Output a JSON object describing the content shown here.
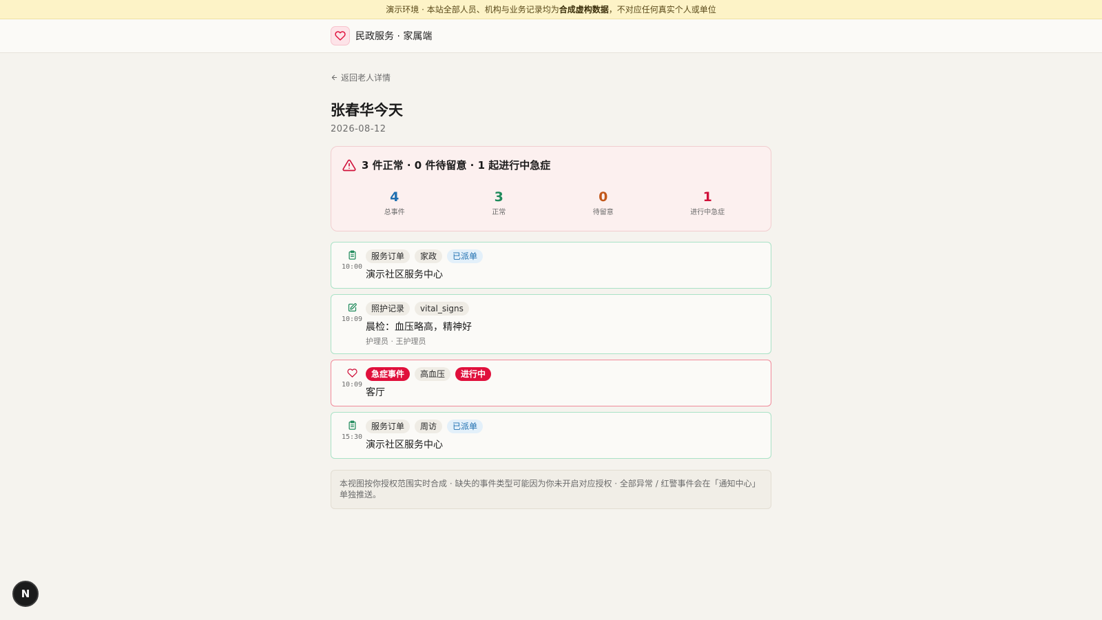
{
  "banner": {
    "prefix": "演示环境 · 本站全部人员、机构与业务记录均为",
    "bold": "合成虚构数据",
    "suffix": "，不对应任何真实个人或单位"
  },
  "header": {
    "brand_name": "民政服务 · 家属端",
    "brand_icon": "heart-icon"
  },
  "nav": {
    "back_label": "返回老人详情"
  },
  "page": {
    "title": "张春华今天",
    "date": "2026-08-12"
  },
  "summary": {
    "headline": "3 件正常 · 0 件待留意 · 1 起进行中急症",
    "stats": [
      {
        "value": "4",
        "label": "总事件",
        "color": "#1f6fb0"
      },
      {
        "value": "3",
        "label": "正常",
        "color": "#1f8a5b"
      },
      {
        "value": "0",
        "label": "待留意",
        "color": "#c2581a"
      },
      {
        "value": "1",
        "label": "进行中急症",
        "color": "#d0103a"
      }
    ]
  },
  "events": [
    {
      "icon": "clipboard-icon",
      "time": "10:00",
      "tags": [
        "服务订单",
        "家政",
        "已派单"
      ],
      "title": "演示社区服务中心",
      "sub": ""
    },
    {
      "icon": "edit-note-icon",
      "time": "10:09",
      "tags": [
        "照护记录",
        "vital_signs"
      ],
      "title": "晨检：血压略高，精神好",
      "sub": "护理员 · 王护理员"
    },
    {
      "icon": "heart-icon",
      "time": "10:09",
      "tags": [
        "急症事件",
        "高血压",
        "进行中"
      ],
      "title": "客厅",
      "sub": ""
    },
    {
      "icon": "clipboard-icon",
      "time": "15:30",
      "tags": [
        "服务订单",
        "周访",
        "已派单"
      ],
      "title": "演示社区服务中心",
      "sub": ""
    }
  ],
  "note": "本视图按你授权范围实时合成 · 缺失的事件类型可能因为你未开启对应授权 · 全部异常 / 红警事件会在「通知中心」单独推送。",
  "fab": {
    "label": "N"
  }
}
